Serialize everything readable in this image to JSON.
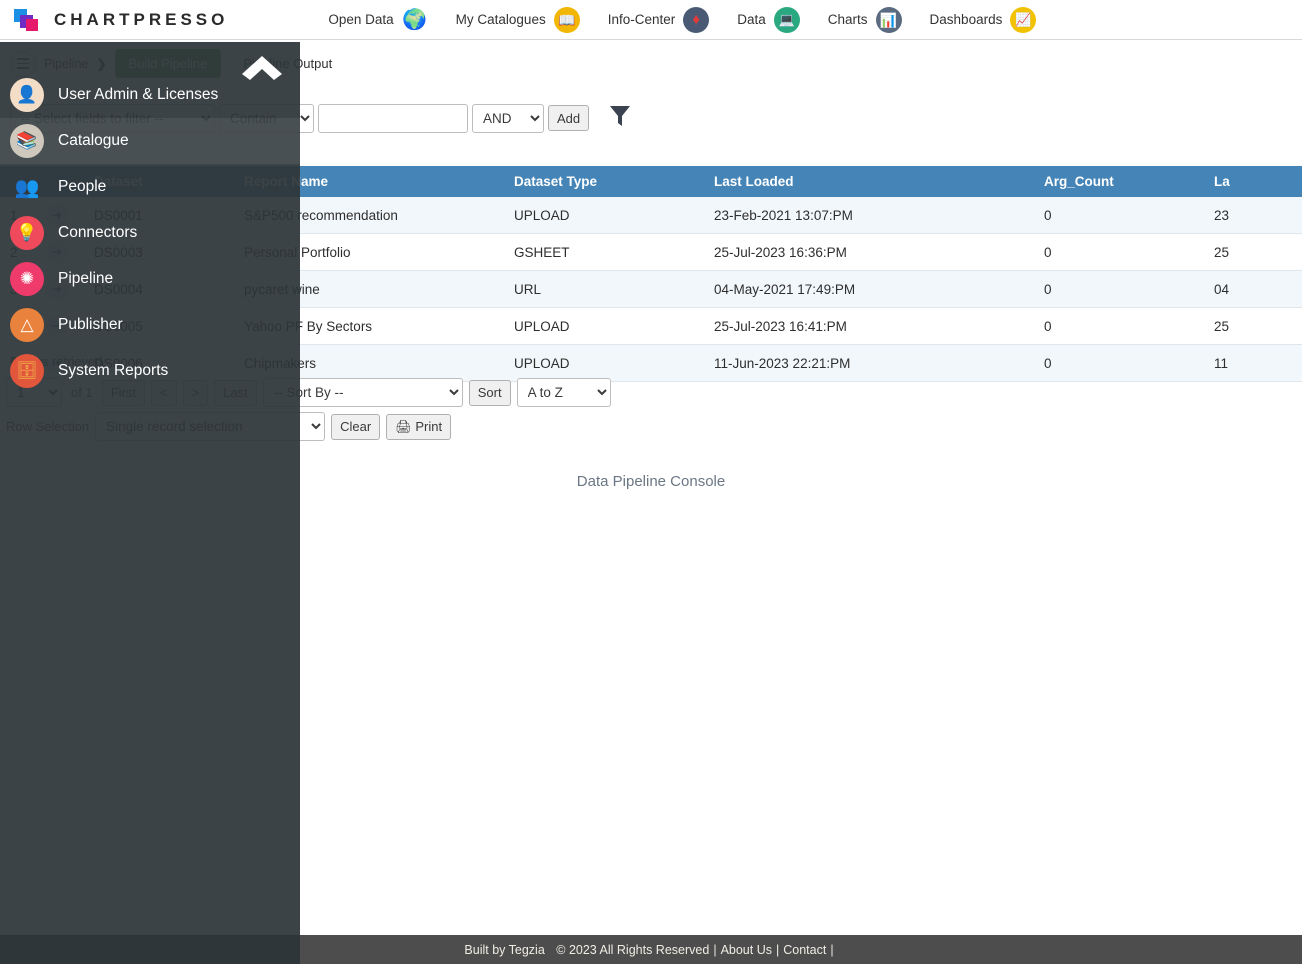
{
  "app": {
    "brand": "CHARTPRESSO",
    "logo_colors": {
      "blue": "#1a8fe3",
      "purple": "#6f2cc4",
      "magenta": "#e6186b"
    },
    "accent": "#4584b6",
    "active_tab_color": "#5e9e5e"
  },
  "topnav": {
    "items": [
      {
        "label": "Open Data",
        "icon": "globe-icon",
        "glyph": "●"
      },
      {
        "label": "My Catalogues",
        "icon": "book-icon",
        "glyph": "▤"
      },
      {
        "label": "Info-Center",
        "icon": "layers-icon",
        "glyph": "◆"
      },
      {
        "label": "Data",
        "icon": "monitor-icon",
        "glyph": "▬"
      },
      {
        "label": "Charts",
        "icon": "bar-chart-icon",
        "glyph": "▐"
      },
      {
        "label": "Dashboards",
        "icon": "dashboard-icon",
        "glyph": "▦"
      }
    ]
  },
  "breadcrumb": {
    "root": "Pipeline",
    "separator": "❯",
    "tabs": [
      {
        "label": "Build Pipeline",
        "active": true
      },
      {
        "label": "Pipeline Output",
        "active": false
      }
    ]
  },
  "filterbar": {
    "fields_select": "-- Select fields to filter --",
    "operator_select": "Contain",
    "value_input": "",
    "value_placeholder": "",
    "logic_select": "AND",
    "add_label": "Add",
    "funnel_icon": "filter-funnel-icon"
  },
  "table": {
    "columns": [
      "",
      "",
      "Dataset",
      "Report Name",
      "Dataset Type",
      "Last Loaded",
      "Arg_Count",
      "La"
    ],
    "rows": [
      {
        "num": "1",
        "arrow": "➜",
        "dataset": "DS0001",
        "report_name": "S&P500 recommendation",
        "dataset_type": "UPLOAD",
        "last_loaded": "23-Feb-2021 13:07:PM",
        "arg_count": "0",
        "last_col": "23"
      },
      {
        "num": "2",
        "arrow": "➜",
        "dataset": "DS0003",
        "report_name": "Personal Portfolio",
        "dataset_type": "GSHEET",
        "last_loaded": "25-Jul-2023 16:36:PM",
        "arg_count": "0",
        "last_col": "25"
      },
      {
        "num": "3",
        "arrow": "➜",
        "dataset": "DS0004",
        "report_name": "pycaret wine",
        "dataset_type": "URL",
        "last_loaded": "04-May-2021 17:49:PM",
        "arg_count": "0",
        "last_col": "04"
      },
      {
        "num": "4",
        "arrow": "➜",
        "dataset": "DS0005",
        "report_name": "Yahoo PF By Sectors",
        "dataset_type": "UPLOAD",
        "last_loaded": "25-Jul-2023 16:41:PM",
        "arg_count": "0",
        "last_col": "25"
      },
      {
        "num": "5",
        "arrow": "➜",
        "dataset": "DS0006",
        "report_name": "Chipmakers",
        "dataset_type": "UPLOAD",
        "last_loaded": "11-Jun-2023 22:21:PM",
        "arg_count": "0",
        "last_col": "11"
      }
    ]
  },
  "status": {
    "text": "5 rows retrieved"
  },
  "pager": {
    "page_select": "1",
    "of_label": "of 1",
    "first_label": "First",
    "prev_label": "<",
    "next_label": ">",
    "last_label": "Last",
    "sort_by_select": "-- Sort By --",
    "sort_label": "Sort",
    "sort_dir_select": "A to Z"
  },
  "tools": {
    "row_selection_label": "Row Selection",
    "row_selection_select": "Single record selection",
    "clear_label": "Clear",
    "print_label": "Print",
    "print_icon": "printer-icon"
  },
  "console": {
    "label": "Data Pipeline Console"
  },
  "sidebar": {
    "collapse_icon": "chevron-up-icon",
    "items": [
      {
        "label": "User Admin & Licenses",
        "icon": "user-admin-icon",
        "glyph": "♟",
        "active": false
      },
      {
        "label": "Catalogue",
        "icon": "catalogue-books-icon",
        "glyph": "≡",
        "active": true
      },
      {
        "label": "People",
        "icon": "people-icon",
        "glyph": "⚬",
        "active": false
      },
      {
        "label": "Connectors",
        "icon": "lightbulb-icon",
        "glyph": "●",
        "active": false
      },
      {
        "label": "Pipeline",
        "icon": "pipeline-nodes-icon",
        "glyph": "✲",
        "active": false
      },
      {
        "label": "Publisher",
        "icon": "publisher-easel-icon",
        "glyph": "△",
        "active": false
      },
      {
        "label": "System Reports",
        "icon": "system-reports-icon",
        "glyph": "▤",
        "active": false
      }
    ]
  },
  "footer": {
    "built_by": "Built by Tegzia",
    "copyright": "© 2023 All Rights Reserved",
    "about": "About Us",
    "contact": "Contact",
    "sep": "|"
  }
}
